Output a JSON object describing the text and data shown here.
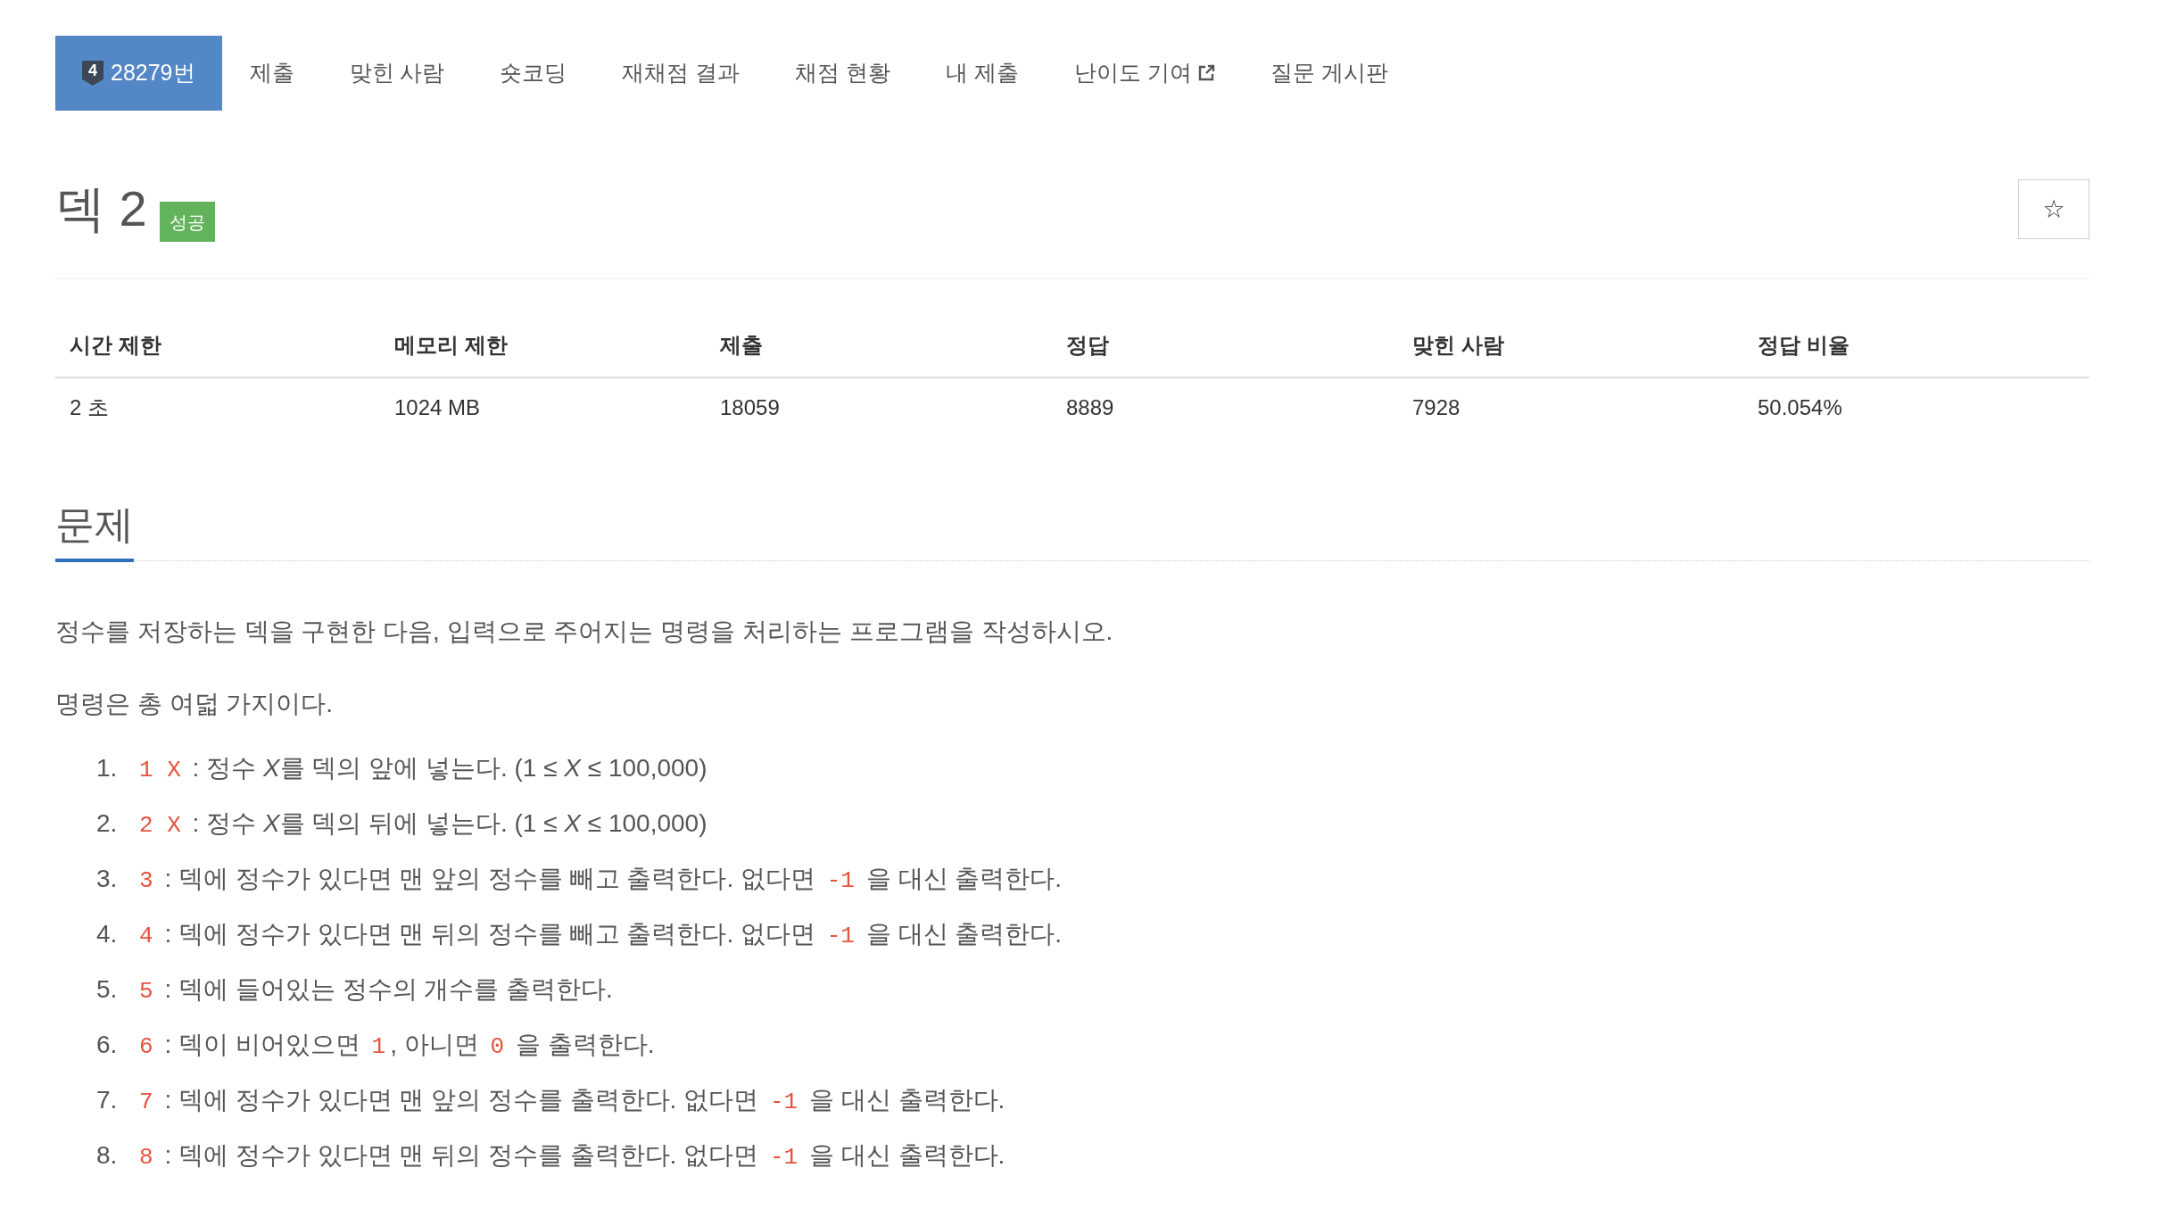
{
  "nav_tabs": [
    {
      "label": "28279번",
      "selected": true,
      "tier": "4",
      "external": false
    },
    {
      "label": "제출",
      "selected": false,
      "external": false
    },
    {
      "label": "맞힌 사람",
      "selected": false,
      "external": false
    },
    {
      "label": "숏코딩",
      "selected": false,
      "external": false
    },
    {
      "label": "재채점 결과",
      "selected": false,
      "external": false
    },
    {
      "label": "채점 현황",
      "selected": false,
      "external": false
    },
    {
      "label": "내 제출",
      "selected": false,
      "external": false
    },
    {
      "label": "난이도 기여",
      "selected": false,
      "external": true
    },
    {
      "label": "질문 게시판",
      "selected": false,
      "external": false
    }
  ],
  "title": "덱 2",
  "status_badge": "성공",
  "star_button": "☆",
  "info_table": {
    "columns": [
      "시간 제한",
      "메모리 제한",
      "제출",
      "정답",
      "맞힌 사람",
      "정답 비율"
    ],
    "rows": [
      [
        "2 초",
        "1024 MB",
        "18059",
        "8889",
        "7928",
        "50.054%"
      ]
    ]
  },
  "section": {
    "title": "문제",
    "paragraphs": [
      "정수를 저장하는 덱을 구현한 다음, 입력으로 주어지는 명령을 처리하는 프로그램을 작성하시오.",
      "명령은 총 여덟 가지이다."
    ],
    "commands": [
      {
        "number": "1.",
        "segments": [
          {
            "kind": "code",
            "text": "1 X"
          },
          {
            "kind": "text",
            "text": " : 정수 "
          },
          {
            "kind": "math",
            "text": "X"
          },
          {
            "kind": "text",
            "text": "를 덱의 앞에 넣는다. (1 ≤ "
          },
          {
            "kind": "math",
            "text": "X"
          },
          {
            "kind": "text",
            "text": " ≤ 100,000)"
          }
        ]
      },
      {
        "number": "2.",
        "segments": [
          {
            "kind": "code",
            "text": "2 X"
          },
          {
            "kind": "text",
            "text": " : 정수 "
          },
          {
            "kind": "math",
            "text": "X"
          },
          {
            "kind": "text",
            "text": "를 덱의 뒤에 넣는다. (1 ≤ "
          },
          {
            "kind": "math",
            "text": "X"
          },
          {
            "kind": "text",
            "text": " ≤ 100,000)"
          }
        ]
      },
      {
        "number": "3.",
        "segments": [
          {
            "kind": "code",
            "text": "3"
          },
          {
            "kind": "text",
            "text": " : 덱에 정수가 있다면 맨 앞의 정수를 빼고 출력한다. 없다면 "
          },
          {
            "kind": "code",
            "text": "-1"
          },
          {
            "kind": "text",
            "text": " 을 대신 출력한다."
          }
        ]
      },
      {
        "number": "4.",
        "segments": [
          {
            "kind": "code",
            "text": "4"
          },
          {
            "kind": "text",
            "text": " : 덱에 정수가 있다면 맨 뒤의 정수를 빼고 출력한다. 없다면 "
          },
          {
            "kind": "code",
            "text": "-1"
          },
          {
            "kind": "text",
            "text": " 을 대신 출력한다."
          }
        ]
      },
      {
        "number": "5.",
        "segments": [
          {
            "kind": "code",
            "text": "5"
          },
          {
            "kind": "text",
            "text": " : 덱에 들어있는 정수의 개수를 출력한다."
          }
        ]
      },
      {
        "number": "6.",
        "segments": [
          {
            "kind": "code",
            "text": "6"
          },
          {
            "kind": "text",
            "text": " : 덱이 비어있으면 "
          },
          {
            "kind": "code",
            "text": "1"
          },
          {
            "kind": "text",
            "text": ", 아니면 "
          },
          {
            "kind": "code",
            "text": "0"
          },
          {
            "kind": "text",
            "text": " 을 출력한다."
          }
        ]
      },
      {
        "number": "7.",
        "segments": [
          {
            "kind": "code",
            "text": "7"
          },
          {
            "kind": "text",
            "text": " : 덱에 정수가 있다면 맨 앞의 정수를 출력한다. 없다면 "
          },
          {
            "kind": "code",
            "text": "-1"
          },
          {
            "kind": "text",
            "text": " 을 대신 출력한다."
          }
        ]
      },
      {
        "number": "8.",
        "segments": [
          {
            "kind": "code",
            "text": "8"
          },
          {
            "kind": "text",
            "text": " : 덱에 정수가 있다면 맨 뒤의 정수를 출력한다. 없다면 "
          },
          {
            "kind": "code",
            "text": "-1"
          },
          {
            "kind": "text",
            "text": " 을 대신 출력한다."
          }
        ]
      }
    ]
  }
}
